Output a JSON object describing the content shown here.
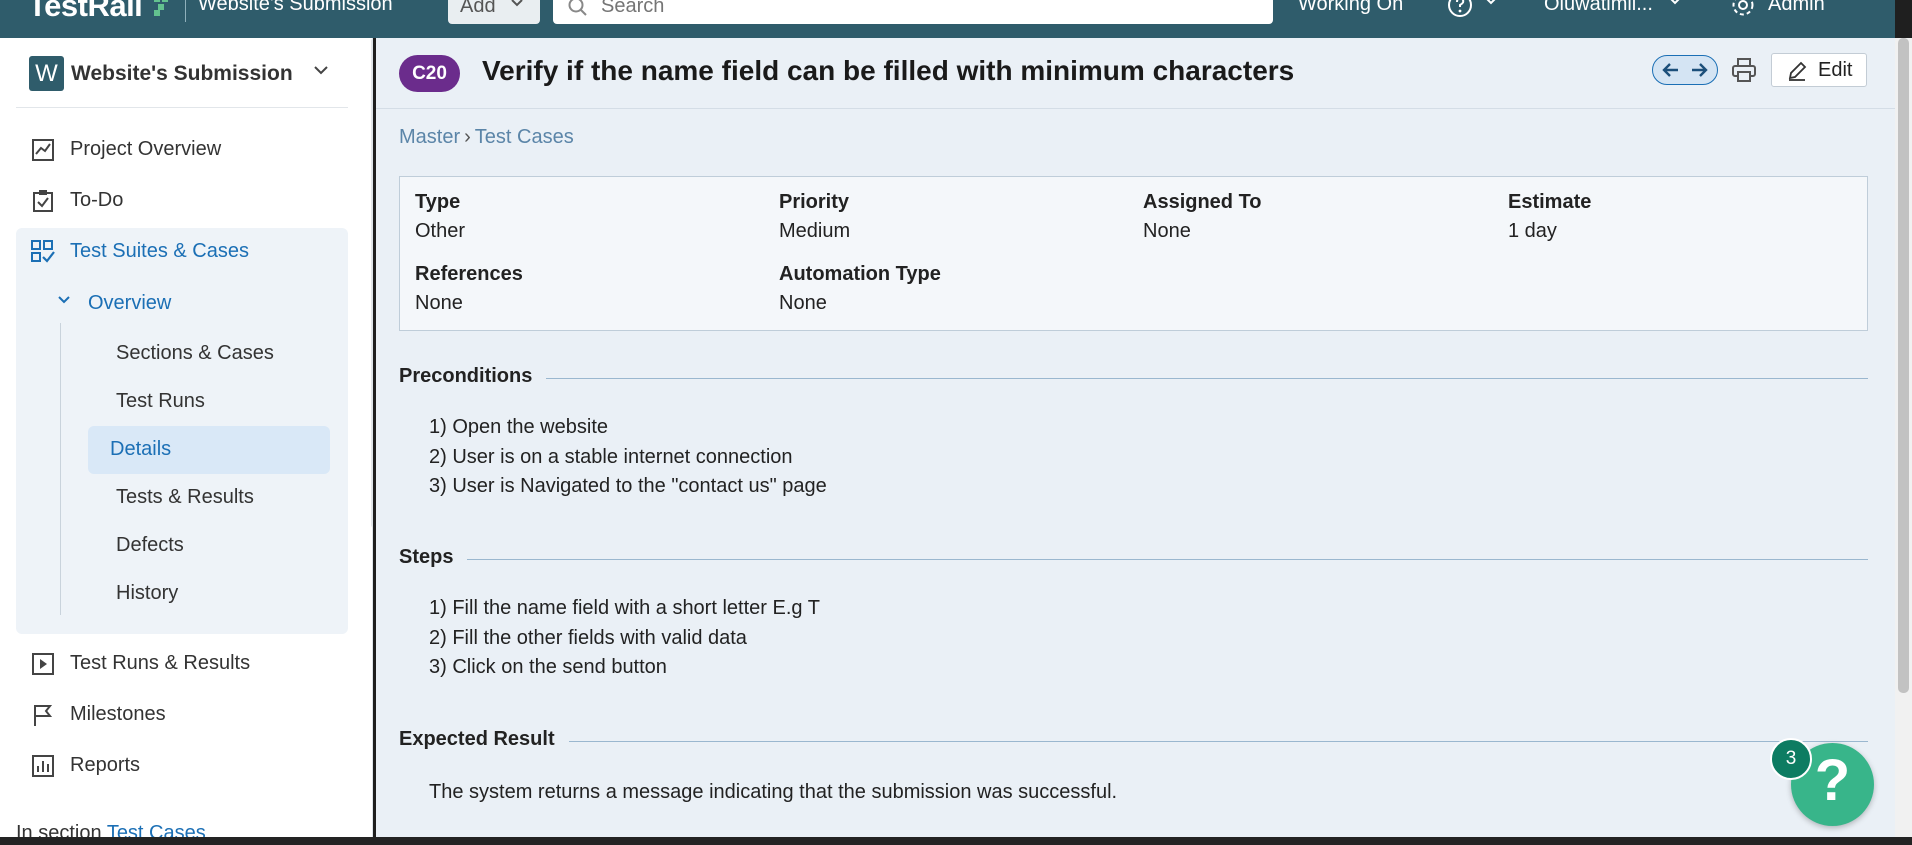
{
  "topbar": {
    "logo": "TestRail",
    "project": "Website's Submission",
    "add_label": "Add",
    "search_placeholder": "Search",
    "working_on": "Working On",
    "user": "Oluwatimil...",
    "admin": "Admin"
  },
  "sidebar": {
    "avatar_letter": "W",
    "project_name": "Website's Submission",
    "nav": {
      "project_overview": "Project Overview",
      "todo": "To-Do",
      "test_suites": "Test Suites & Cases",
      "test_runs_results": "Test Runs & Results",
      "milestones": "Milestones",
      "reports": "Reports"
    },
    "sub_toggle": "Overview",
    "sub_items": [
      "Sections & Cases",
      "Test Runs",
      "Details",
      "Tests & Results",
      "Defects",
      "History"
    ],
    "in_section_prefix": "In section",
    "in_section_link": "Test Cases"
  },
  "case": {
    "id": "C20",
    "title": "Verify if the name field can be filled with minimum characters",
    "edit_label": "Edit",
    "breadcrumb": [
      "Master",
      "Test Cases"
    ],
    "breadcrumb_sep": "›",
    "properties": {
      "type_label": "Type",
      "type_value": "Other",
      "priority_label": "Priority",
      "priority_value": "Medium",
      "assigned_label": "Assigned To",
      "assigned_value": "None",
      "estimate_label": "Estimate",
      "estimate_value": "1 day",
      "references_label": "References",
      "references_value": "None",
      "automation_label": "Automation Type",
      "automation_value": "None"
    },
    "preconditions_title": "Preconditions",
    "preconditions": [
      "1) Open the website",
      "2) User is on a stable internet connection",
      "3) User is Navigated to the \"contact us\" page"
    ],
    "steps_title": "Steps",
    "steps": [
      "1) Fill the name field with a short letter E.g T",
      "2) Fill the other fields with valid data",
      "3) Click on the send button"
    ],
    "expected_title": "Expected Result",
    "expected": "The system returns a message indicating that the submission was successful."
  },
  "help": {
    "badge_count": "3",
    "symbol": "?"
  },
  "colors": {
    "topbar": "#2f5c6b",
    "accent": "#1b6fb5",
    "case_badge": "#6b2c8c",
    "help": "#38b58a"
  }
}
